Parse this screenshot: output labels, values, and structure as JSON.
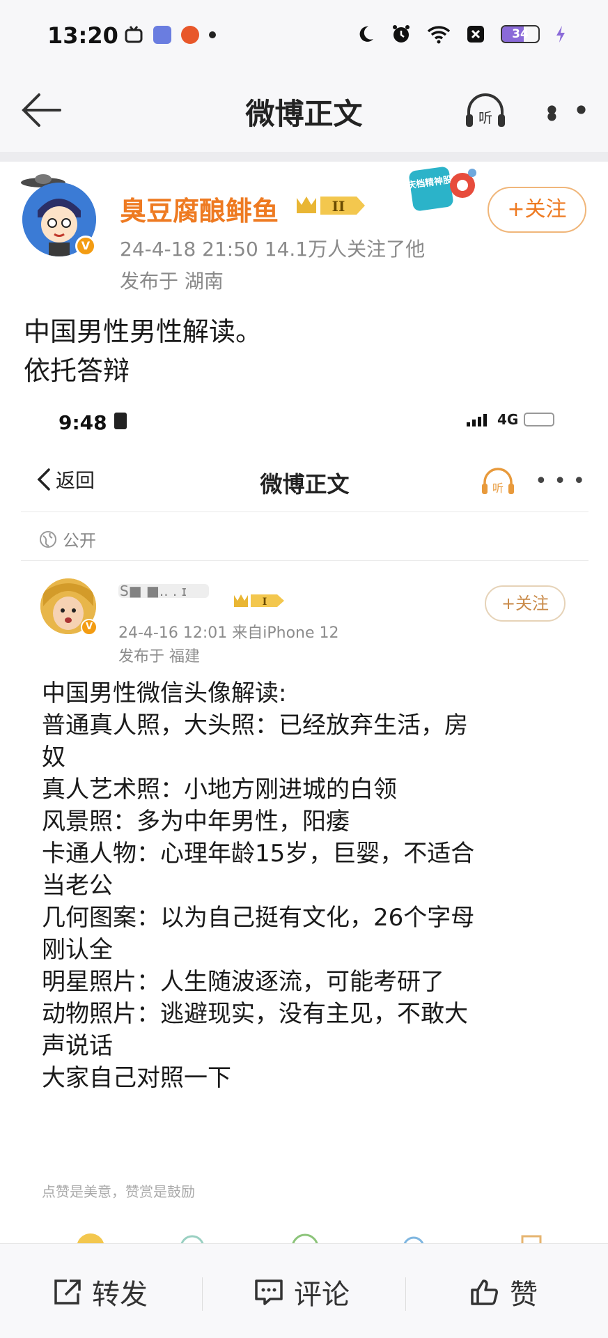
{
  "status_bar": {
    "time": "13:20",
    "battery": "34"
  },
  "nav": {
    "title": "微博正文"
  },
  "post": {
    "author": "臭豆腐酿鲱鱼",
    "level_badge": "II",
    "verified_badge": "V",
    "meta_line": "24-4-18 21:50   14.1万人关注了他",
    "location": "发布于 湖南",
    "follow_label": "+关注",
    "text_line1": "中国男性男性解读。",
    "text_line2": "依托答辩"
  },
  "embedded": {
    "status_time": "9:48",
    "network": "4G",
    "back_label": "返回",
    "nav_title": "微博正文",
    "listen_label": "听",
    "visibility": "公开",
    "author_blurred": "S■ ■.. . ɪ",
    "level_badge": "I",
    "verified_badge": "V",
    "meta_line": "24-4-16 12:01   来自iPhone 12",
    "location": "发布于 福建",
    "follow_label": "+关注",
    "body_lines": [
      "中国男性微信头像解读:",
      "普通真人照，大头照：已经放弃生活，房",
      "奴",
      "真人艺术照：小地方刚进城的白领",
      "风景照：多为中年男性，阳痿",
      "卡通人物：心理年龄15岁，巨婴，不适合",
      "当老公",
      "几何图案：以为自己挺有文化，26个字母",
      "刚认全",
      "明星照片：人生随波逐流，可能考研了",
      "动物照片：逃避现实，没有主见，不敢大",
      "声说话",
      "大家自己对照一下"
    ],
    "reward_text": "点赞是美意，赞赏是鼓励"
  },
  "sticker": {
    "text": "国庆档精神股东"
  },
  "listen_label": "听",
  "actions": {
    "repost": "转发",
    "comment": "评论",
    "like": "赞"
  },
  "colors": {
    "accent": "#ee7a21",
    "follow_border": "#f0b67a",
    "meta": "#8a8a8a"
  }
}
